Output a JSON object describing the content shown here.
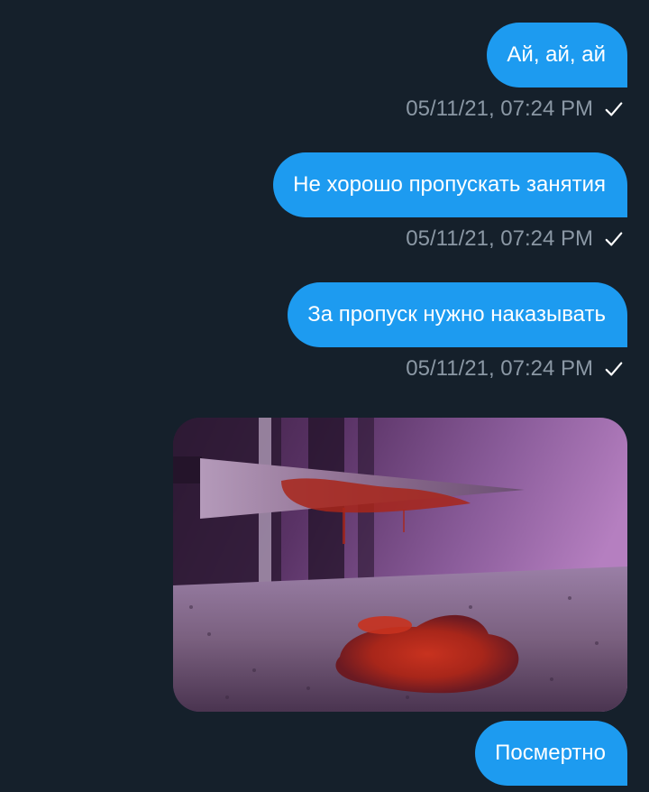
{
  "messages": [
    {
      "text": "Ай, ай, ай",
      "time": "05/11/21, 07:24 PM"
    },
    {
      "text": "Не хорошо пропускать занятия",
      "time": "05/11/21, 07:24 PM"
    },
    {
      "text": "За пропуск нужно наказывать",
      "time": "05/11/21, 07:24 PM"
    },
    {
      "text": "Посмертно"
    }
  ],
  "colors": {
    "background": "#15202b",
    "bubble": "#1d9bf0",
    "meta_text": "#8b98a5"
  },
  "icons": {
    "read_receipt": "check-icon",
    "media": "knife-photo"
  }
}
